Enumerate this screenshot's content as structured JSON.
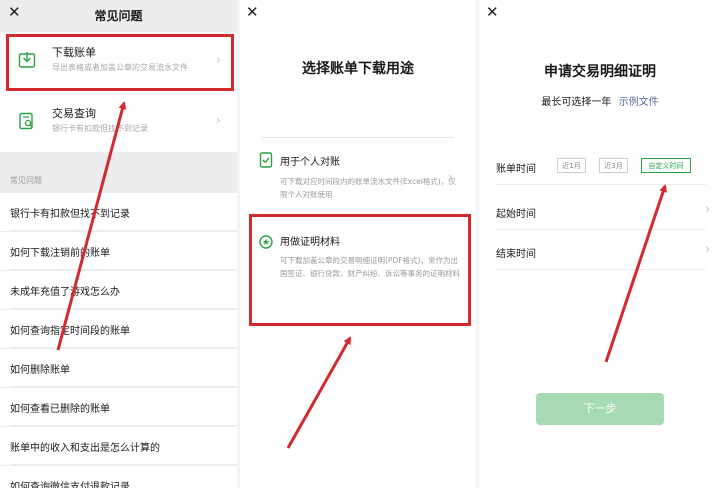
{
  "panel1": {
    "close_glyph": "✕",
    "title": "常见问题",
    "download": {
      "title": "下载账单",
      "subtitle": "导出表格或者加盖公章的交易流水文件"
    },
    "query": {
      "title": "交易查询",
      "subtitle": "银行卡有扣款但找不到记录"
    },
    "section_label": "常见问题",
    "faq_items": [
      "银行卡有扣款但找不到记录",
      "如何下载注销前的账单",
      "未成年充值了游戏怎么办",
      "如何查询指定时间段的账单",
      "如何删除账单",
      "如何查看已删除的账单",
      "账单中的收入和支出是怎么计算的",
      "如何查询微信支付退款记录"
    ]
  },
  "panel2": {
    "close_glyph": "✕",
    "heading": "选择账单下载用途",
    "option_personal": {
      "title": "用于个人对账",
      "desc": "可下载对应时间段内的账单流水文件(Excel格式)，仅限个人对账使用"
    },
    "option_proof": {
      "title": "用做证明材料",
      "desc": "可下载加盖公章的交易明细证明(PDF格式)，常作为出国签证、银行贷款、财产纠纷、诉讼等事务的证明材料"
    }
  },
  "panel3": {
    "close_glyph": "✕",
    "heading": "申请交易明细证明",
    "subtitle_prefix": "最长可选择一年",
    "subtitle_link": "示例文件",
    "bill_time_label": "账单时间",
    "chips": [
      "近1月",
      "近3月",
      "自定义时间"
    ],
    "start_label": "起始时间",
    "end_label": "结束时间",
    "next_button": "下一步"
  },
  "colors": {
    "accent_green": "#07c160",
    "highlight_red": "#d42a2f",
    "button_disabled": "#a5dab2"
  },
  "icons": [
    "close-icon",
    "download-icon",
    "search-doc-icon",
    "document-check-icon",
    "star-circle-icon",
    "chevron-right-icon"
  ]
}
